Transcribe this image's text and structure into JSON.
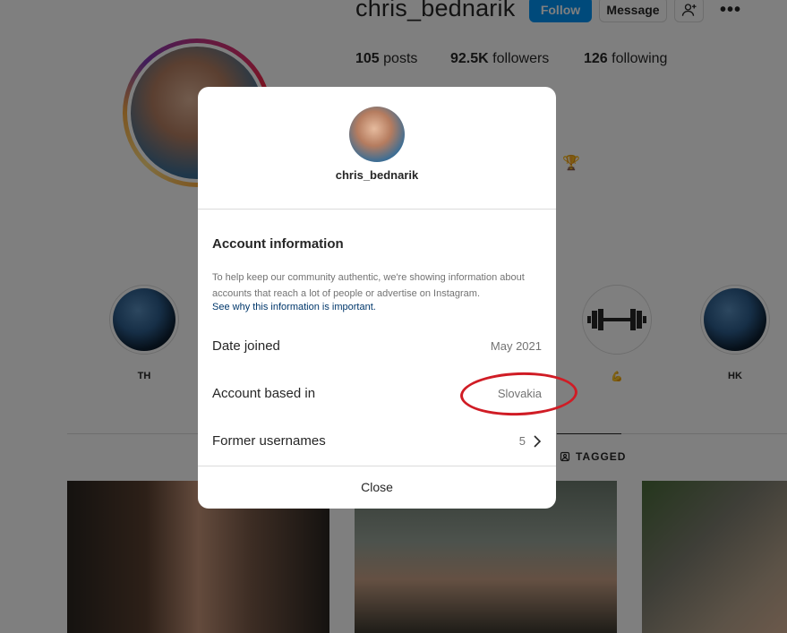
{
  "profile": {
    "username": "chris_bednarik",
    "follow_label": "Follow",
    "message_label": "Message",
    "more_icon": "more-icon",
    "stats": {
      "posts_count": "105",
      "posts_label": "posts",
      "followers_count": "92.5K",
      "followers_label": "followers",
      "following_count": "126",
      "following_label": "following"
    },
    "bio_emoji": "🏆"
  },
  "highlights": [
    {
      "label": "TH"
    },
    {
      "label": "💪"
    },
    {
      "label": "HK"
    }
  ],
  "tabs": {
    "tagged_label": "TAGGED"
  },
  "modal": {
    "username": "chris_bednarik",
    "heading": "Account information",
    "description": "To help keep our community authentic, we're showing information about accounts that reach a lot of people or advertise on Instagram.",
    "link_text": "See why this information is important.",
    "rows": [
      {
        "label": "Date joined",
        "value": "May 2021"
      },
      {
        "label": "Account based in",
        "value": "Slovakia"
      },
      {
        "label": "Former usernames",
        "value": "5"
      }
    ],
    "close_label": "Close"
  },
  "annotation": {
    "color": "#d01c25"
  },
  "colors": {
    "accent": "#0095f6",
    "link": "#00376b",
    "overlay": "rgba(0,0,0,0.5)"
  }
}
